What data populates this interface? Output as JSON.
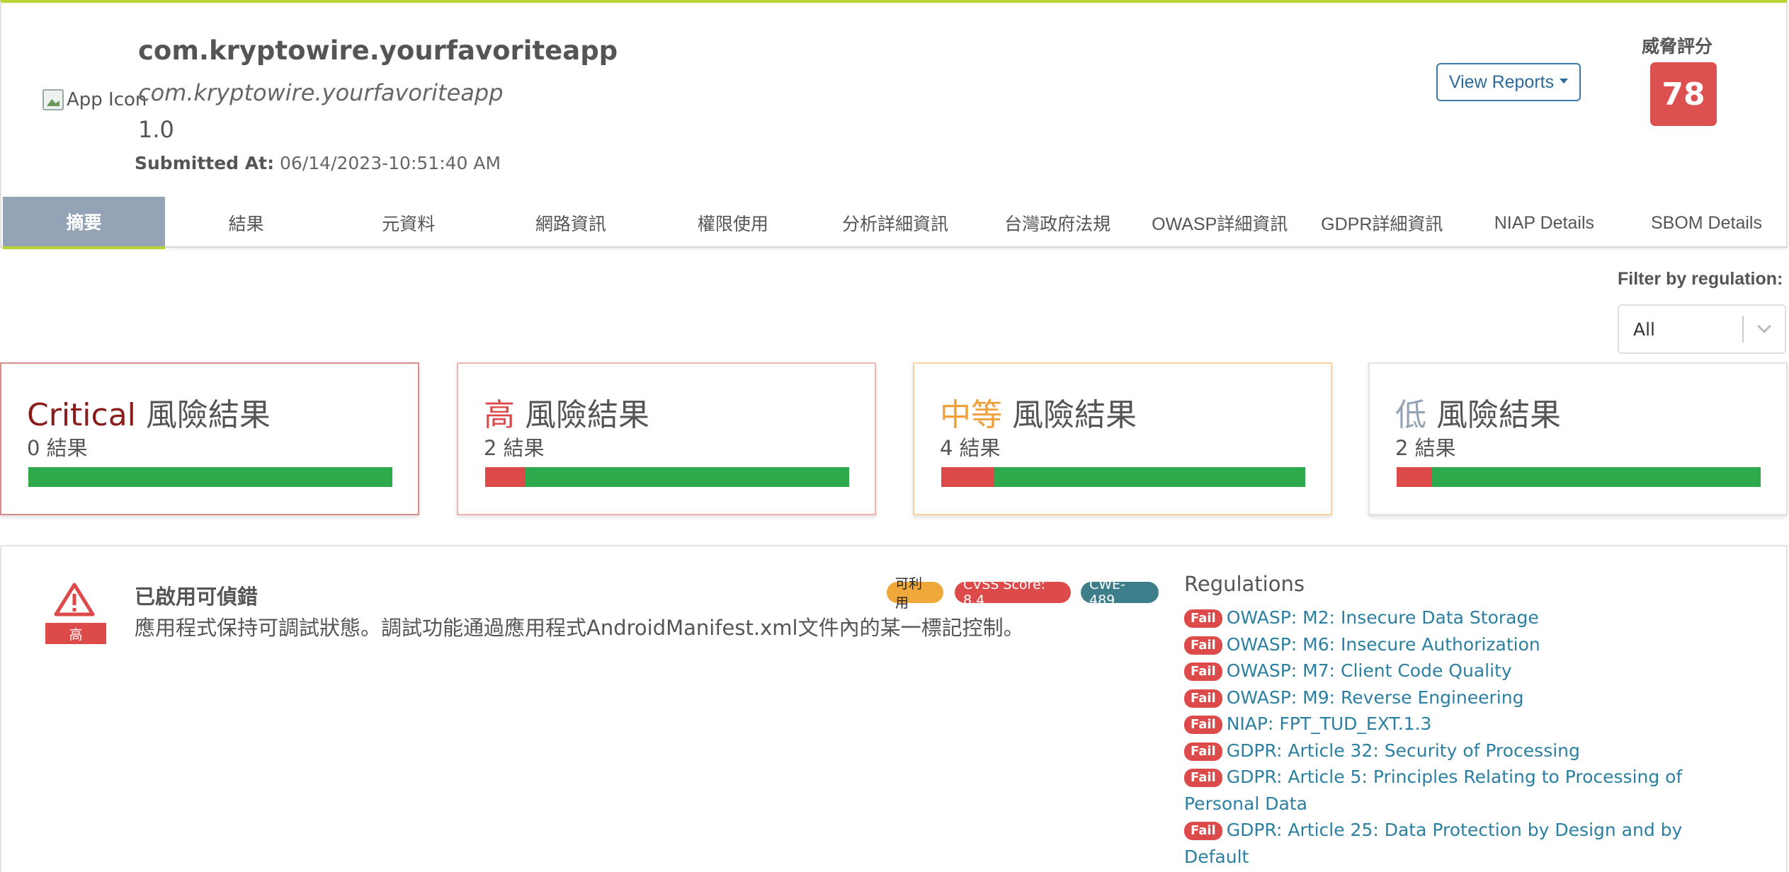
{
  "app": {
    "icon_alt": "App Icon",
    "title": "com.kryptowire.yourfavoriteapp",
    "package": "com.kryptowire.yourfavoriteapp",
    "version": "1.0",
    "submitted_label": "Submitted At:",
    "submitted_value": "06/14/2023-10:51:40 AM"
  },
  "actions": {
    "view_reports": "View Reports"
  },
  "threat": {
    "label": "威脅評分",
    "score": "78",
    "color": "#dd5050"
  },
  "tabs": [
    {
      "label": "摘要",
      "active": true
    },
    {
      "label": "結果"
    },
    {
      "label": "元資料"
    },
    {
      "label": "網路資訊"
    },
    {
      "label": "權限使用"
    },
    {
      "label": "分析詳細資訊"
    },
    {
      "label": "台灣政府法規"
    },
    {
      "label": "OWASP詳細資訊"
    },
    {
      "label": "GDPR詳細資訊"
    },
    {
      "label": "NIAP Details"
    },
    {
      "label": "SBOM Details"
    }
  ],
  "filter": {
    "label": "Filter by regulation:",
    "value": "All"
  },
  "risk_cards": [
    {
      "level": "Critical",
      "suffix": "風險結果",
      "count": "0 結果",
      "level_color": "#8b1c1c",
      "border": "#d98b8b",
      "red_fraction": 0.0
    },
    {
      "level": "高",
      "suffix": "風險結果",
      "count": "2 結果",
      "level_color": "#dd4a4a",
      "border": "#f2b3b3",
      "red_fraction": 0.11
    },
    {
      "level": "中等",
      "suffix": "風險結果",
      "count": "4 結果",
      "level_color": "#f0a03a",
      "border": "#f9d4a3",
      "red_fraction": 0.145
    },
    {
      "level": "低",
      "suffix": "風險結果",
      "count": "2 結果",
      "level_color": "#95a3b6",
      "border": "#e2e2e2",
      "red_fraction": 0.095
    }
  ],
  "finding": {
    "severity": "高",
    "title": "已啟用可偵錯",
    "description": "應用程式保持可調試狀態。調試功能通過應用程式AndroidManifest.xml文件內的某一標記控制。",
    "tags": {
      "exploitable": "可利用",
      "cvss": "CVSS Score: 8.4",
      "cwe": "CWE-489"
    },
    "regulations_title": "Regulations",
    "fail_label": "Fail",
    "regulations": [
      "OWASP: M2: Insecure Data Storage",
      "OWASP: M6: Insecure Authorization",
      "OWASP: M7: Client Code Quality",
      "OWASP: M9: Reverse Engineering",
      "NIAP: FPT_TUD_EXT.1.3",
      "GDPR: Article 32: Security of Processing",
      "GDPR: Article 5: Principles Relating to Processing of Personal Data",
      "GDPR: Article 25: Data Protection by Design and by Default"
    ]
  }
}
